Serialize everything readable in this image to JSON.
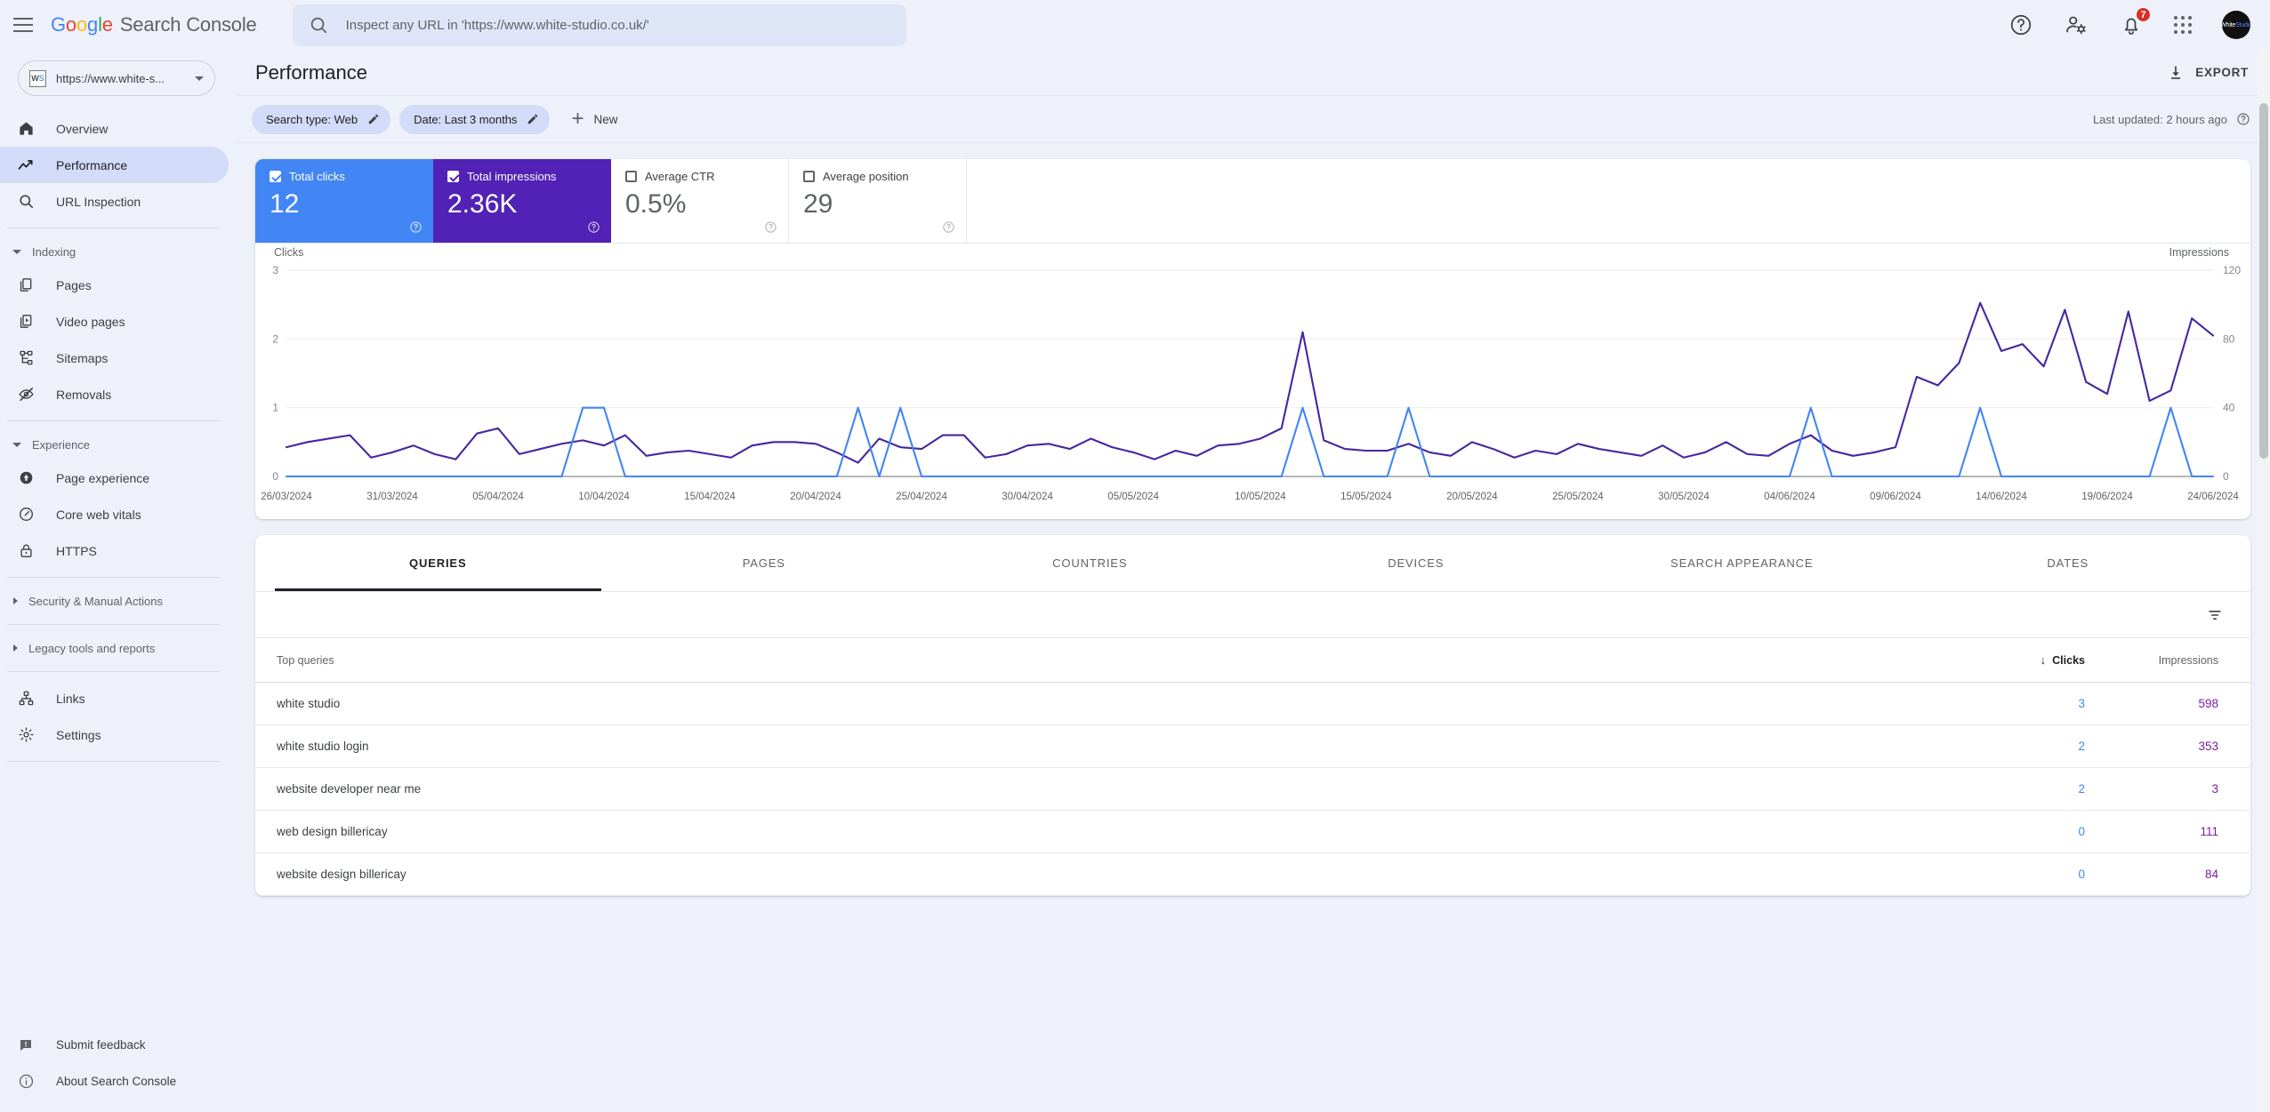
{
  "topbar": {
    "menu_icon": "hamburger-icon",
    "brand": {
      "google": "Google",
      "product": "Search Console"
    },
    "search": {
      "icon": "search-icon",
      "placeholder": "Inspect any URL in 'https://www.white-studio.co.uk/'",
      "value": ""
    },
    "help_icon": "help-icon",
    "account_icon": "account-settings-icon",
    "notifications_icon": "bell-icon",
    "notifications_count": "7",
    "apps_icon": "apps-grid-icon",
    "avatar_text": "WhiteStudio"
  },
  "sidebar": {
    "property": {
      "icon_text_w": "W",
      "icon_text_s": "S",
      "label": "https://www.white-s...",
      "chevron": "chevron-down-icon"
    },
    "items": [
      {
        "label": "Overview",
        "icon": "home-icon",
        "active": false
      },
      {
        "label": "Performance",
        "icon": "trending-up-icon",
        "active": true
      },
      {
        "label": "URL Inspection",
        "icon": "search-icon",
        "active": false
      }
    ],
    "groups": [
      {
        "title": "Indexing",
        "expanded": true,
        "items": [
          {
            "label": "Pages",
            "icon": "pages-icon"
          },
          {
            "label": "Video pages",
            "icon": "video-pages-icon"
          },
          {
            "label": "Sitemaps",
            "icon": "sitemap-icon"
          },
          {
            "label": "Removals",
            "icon": "eye-off-icon"
          }
        ]
      },
      {
        "title": "Experience",
        "expanded": true,
        "items": [
          {
            "label": "Page experience",
            "icon": "page-experience-icon"
          },
          {
            "label": "Core web vitals",
            "icon": "speedometer-icon"
          },
          {
            "label": "HTTPS",
            "icon": "lock-icon"
          }
        ]
      },
      {
        "title": "Security & Manual Actions",
        "expanded": false,
        "items": []
      },
      {
        "title": "Legacy tools and reports",
        "expanded": false,
        "items": []
      }
    ],
    "tail_items": [
      {
        "label": "Links",
        "icon": "links-icon"
      },
      {
        "label": "Settings",
        "icon": "gear-icon"
      }
    ],
    "bottom_items": [
      {
        "label": "Submit feedback",
        "icon": "feedback-icon"
      },
      {
        "label": "About Search Console",
        "icon": "info-icon"
      }
    ]
  },
  "header": {
    "title": "Performance",
    "export_label": "EXPORT",
    "export_icon": "download-icon"
  },
  "filters": {
    "chips": [
      {
        "label": "Search type: Web",
        "icon": "pencil-icon"
      },
      {
        "label": "Date: Last 3 months",
        "icon": "pencil-icon"
      }
    ],
    "new_label": "New",
    "new_icon": "plus-icon",
    "last_updated": "Last updated: 2 hours ago",
    "last_updated_icon": "help-icon"
  },
  "metrics": [
    {
      "label": "Total clicks",
      "value": "12",
      "checked": true,
      "color": "#4285F4",
      "help_icon": "help-icon"
    },
    {
      "label": "Total impressions",
      "value": "2.36K",
      "checked": true,
      "color": "#5122b5",
      "help_icon": "help-icon"
    },
    {
      "label": "Average CTR",
      "value": "0.5%",
      "checked": false,
      "color": "#00897b",
      "help_icon": "help-icon"
    },
    {
      "label": "Average position",
      "value": "29",
      "checked": false,
      "color": "#f9ab00",
      "help_icon": "help-icon"
    }
  ],
  "chart_data": {
    "type": "line",
    "title": "",
    "left_axis": {
      "label": "Clicks",
      "ticks": [
        0,
        1,
        2,
        3
      ],
      "ylim": [
        0,
        3
      ],
      "color": "#4285F4"
    },
    "right_axis": {
      "label": "Impressions",
      "ticks": [
        0,
        40,
        80,
        120
      ],
      "ylim": [
        0,
        120
      ],
      "color": "#4527a0"
    },
    "grid": true,
    "legend": "none",
    "x_tick_labels": [
      "26/03/2024",
      "31/03/2024",
      "05/04/2024",
      "10/04/2024",
      "15/04/2024",
      "20/04/2024",
      "25/04/2024",
      "30/04/2024",
      "05/05/2024",
      "10/05/2024",
      "15/05/2024",
      "20/05/2024",
      "25/05/2024",
      "30/05/2024",
      "04/06/2024",
      "09/06/2024",
      "14/06/2024",
      "19/06/2024",
      "24/06/2024"
    ],
    "x_start": "26/03/2024",
    "x_end": "24/06/2024",
    "series": [
      {
        "name": "Clicks",
        "color": "#4285F4",
        "axis": "left",
        "values": [
          0,
          0,
          0,
          0,
          0,
          0,
          0,
          0,
          0,
          0,
          0,
          0,
          0,
          0,
          1,
          1,
          0,
          0,
          0,
          0,
          0,
          0,
          0,
          0,
          0,
          0,
          0,
          1,
          0,
          1,
          0,
          0,
          0,
          0,
          0,
          0,
          0,
          0,
          0,
          0,
          0,
          0,
          0,
          0,
          0,
          0,
          0,
          0,
          1,
          0,
          0,
          0,
          0,
          1,
          0,
          0,
          0,
          0,
          0,
          0,
          0,
          0,
          0,
          0,
          0,
          0,
          0,
          0,
          0,
          0,
          0,
          0,
          1,
          0,
          0,
          0,
          0,
          0,
          0,
          0,
          1,
          0,
          0,
          0,
          0,
          0,
          0,
          0,
          0,
          1,
          0,
          0
        ]
      },
      {
        "name": "Impressions",
        "color": "#4527a0",
        "axis": "right",
        "values": [
          17,
          20,
          22,
          24,
          11,
          14,
          18,
          13,
          10,
          25,
          28,
          13,
          16,
          19,
          21,
          18,
          24,
          12,
          14,
          15,
          13,
          11,
          18,
          20,
          20,
          19,
          14,
          8,
          22,
          17,
          16,
          24,
          24,
          11,
          13,
          18,
          19,
          16,
          22,
          17,
          14,
          10,
          15,
          12,
          18,
          19,
          22,
          28,
          84,
          21,
          16,
          15,
          15,
          19,
          14,
          12,
          20,
          16,
          11,
          15,
          13,
          19,
          16,
          14,
          12,
          18,
          11,
          14,
          20,
          13,
          12,
          19,
          24,
          15,
          12,
          14,
          17,
          58,
          53,
          66,
          101,
          73,
          77,
          64,
          97,
          55,
          48,
          96,
          44,
          50,
          92,
          82
        ]
      }
    ]
  },
  "tabs": [
    {
      "label": "QUERIES",
      "active": true
    },
    {
      "label": "PAGES",
      "active": false
    },
    {
      "label": "COUNTRIES",
      "active": false
    },
    {
      "label": "DEVICES",
      "active": false
    },
    {
      "label": "SEARCH APPEARANCE",
      "active": false
    },
    {
      "label": "DATES",
      "active": false
    }
  ],
  "table": {
    "filter_icon": "filter-icon",
    "columns": [
      {
        "label": "Top queries",
        "align": "left",
        "sorted": false
      },
      {
        "label": "Clicks",
        "align": "right",
        "sorted": true,
        "sort_icon": "arrow-down-icon"
      },
      {
        "label": "Impressions",
        "align": "right",
        "sorted": false
      }
    ],
    "rows": [
      {
        "query": "white studio",
        "clicks": "3",
        "impressions": "598"
      },
      {
        "query": "white studio login",
        "clicks": "2",
        "impressions": "353"
      },
      {
        "query": "website developer near me",
        "clicks": "2",
        "impressions": "3"
      },
      {
        "query": "web design billericay",
        "clicks": "0",
        "impressions": "111"
      },
      {
        "query": "website design billericay",
        "clicks": "0",
        "impressions": "84"
      }
    ]
  }
}
